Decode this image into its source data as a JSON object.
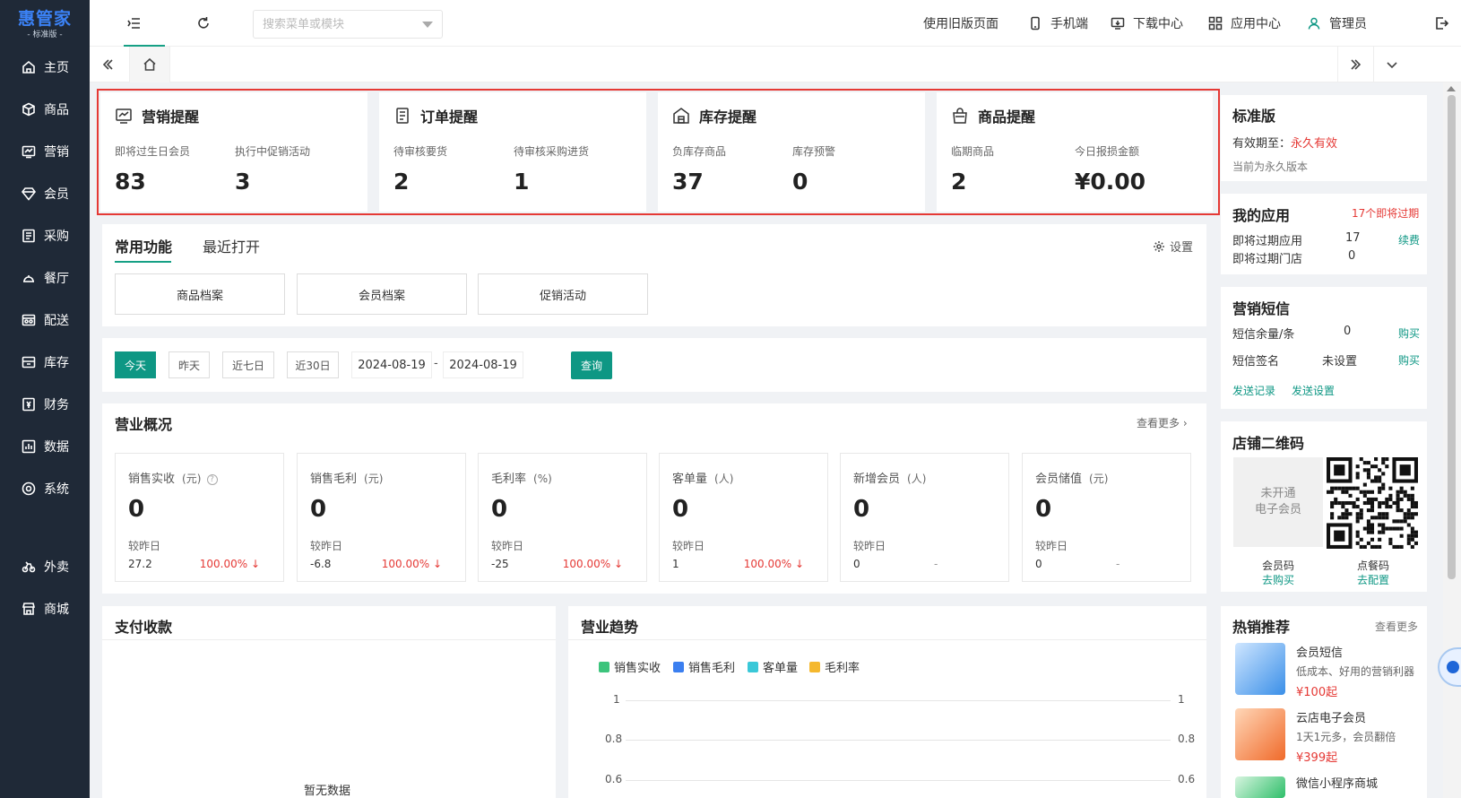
{
  "sidebar": {
    "logo": "惠管家",
    "logo_sub": "- 标准版 -",
    "items": [
      {
        "label": "主页",
        "icon": "home-icon"
      },
      {
        "label": "商品",
        "icon": "box-icon"
      },
      {
        "label": "营销",
        "icon": "chart-icon"
      },
      {
        "label": "会员",
        "icon": "diamond-icon"
      },
      {
        "label": "采购",
        "icon": "list-icon"
      },
      {
        "label": "餐厅",
        "icon": "dining-icon"
      },
      {
        "label": "配送",
        "icon": "delivery-icon"
      },
      {
        "label": "库存",
        "icon": "inventory-icon"
      },
      {
        "label": "财务",
        "icon": "finance-icon"
      },
      {
        "label": "数据",
        "icon": "data-icon"
      },
      {
        "label": "系统",
        "icon": "settings-icon"
      },
      {
        "label": "外卖",
        "icon": "takeout-icon"
      },
      {
        "label": "商城",
        "icon": "store-icon"
      }
    ]
  },
  "topbar": {
    "search_placeholder": "搜索菜单或模块",
    "old_version": "使用旧版页面",
    "mobile": "手机端",
    "download": "下载中心",
    "apps": "应用中心",
    "user": "管理员"
  },
  "alerts": [
    {
      "title": "营销提醒",
      "icon": "trend-icon",
      "items": [
        {
          "label": "即将过生日会员",
          "value": "83"
        },
        {
          "label": "执行中促销活动",
          "value": "3"
        }
      ]
    },
    {
      "title": "订单提醒",
      "icon": "document-icon",
      "items": [
        {
          "label": "待审核要货",
          "value": "2"
        },
        {
          "label": "待审核采购进货",
          "value": "1"
        }
      ]
    },
    {
      "title": "库存提醒",
      "icon": "warehouse-icon",
      "items": [
        {
          "label": "负库存商品",
          "value": "37"
        },
        {
          "label": "库存预警",
          "value": "0"
        }
      ]
    },
    {
      "title": "商品提醒",
      "icon": "bag-icon",
      "items": [
        {
          "label": "临期商品",
          "value": "2"
        },
        {
          "label": "今日报损金额",
          "value": "¥0.00"
        }
      ]
    }
  ],
  "functions": {
    "tabs": [
      "常用功能",
      "最近打开"
    ],
    "settings": "设置",
    "buttons": [
      "商品档案",
      "会员档案",
      "促销活动"
    ]
  },
  "filter": {
    "ranges": [
      "今天",
      "昨天",
      "近七日",
      "近30日"
    ],
    "start_date": "2024-08-19",
    "separator": "-",
    "end_date": "2024-08-19",
    "query": "查询"
  },
  "overview": {
    "title": "营业概况",
    "more": "查看更多",
    "compare_label": "较昨日",
    "metrics": [
      {
        "label": "销售实收",
        "unit": "(元)",
        "value": "0",
        "prev": "27.2",
        "pct": "100.00% ↓"
      },
      {
        "label": "销售毛利",
        "unit": "(元)",
        "value": "0",
        "prev": "-6.8",
        "pct": "100.00% ↓"
      },
      {
        "label": "毛利率",
        "unit": "(%)",
        "value": "0",
        "prev": "-25",
        "pct": "100.00% ↓"
      },
      {
        "label": "客单量",
        "unit": "(人)",
        "value": "0",
        "prev": "1",
        "pct": "100.00% ↓"
      },
      {
        "label": "新增会员",
        "unit": "(人)",
        "value": "0",
        "prev": "0",
        "pct": "-"
      },
      {
        "label": "会员储值",
        "unit": "(元)",
        "value": "0",
        "prev": "0",
        "pct": "-"
      }
    ]
  },
  "payment": {
    "title": "支付收款",
    "empty": "暂无数据"
  },
  "trend": {
    "title": "营业趋势",
    "legend": [
      {
        "name": "销售实收",
        "color": "#3cc47c"
      },
      {
        "name": "销售毛利",
        "color": "#3b7ff0"
      },
      {
        "name": "客单量",
        "color": "#3ac8d8"
      },
      {
        "name": "毛利率",
        "color": "#f5b82e"
      }
    ],
    "ticks": [
      "1",
      "0.8",
      "0.6"
    ]
  },
  "right": {
    "edition": {
      "title": "标准版",
      "expiry_label": "有效期至：",
      "expiry_value": "永久有效",
      "note": "当前为永久版本"
    },
    "apps": {
      "title": "我的应用",
      "badge": "17个即将过期",
      "rows": [
        {
          "label": "即将过期应用",
          "value": "17",
          "action": "续费"
        },
        {
          "label": "即将过期门店",
          "value": "0",
          "action": ""
        }
      ]
    },
    "sms": {
      "title": "营销短信",
      "rows": [
        {
          "label": "短信余量/条",
          "value": "0",
          "action": "购买"
        },
        {
          "label": "短信签名",
          "value": "未设置",
          "action": "购买"
        }
      ],
      "links": [
        "发送记录",
        "发送设置"
      ]
    },
    "qr": {
      "title": "店铺二维码",
      "placeholder": "未开通\n电子会员",
      "placeholder_1": "未开通",
      "placeholder_2": "电子会员",
      "left_label": "会员码",
      "left_action": "去购买",
      "right_label": "点餐码",
      "right_action": "去配置"
    },
    "hot": {
      "title": "热销推荐",
      "more": "查看更多",
      "items": [
        {
          "name": "会员短信",
          "desc": "低成本、好用的营销利器",
          "price": "¥100起"
        },
        {
          "name": "云店电子会员",
          "desc": "1天1元多，会员翻倍",
          "price": "¥399起"
        },
        {
          "name": "微信小程序商城",
          "desc": "",
          "price": ""
        }
      ]
    }
  }
}
